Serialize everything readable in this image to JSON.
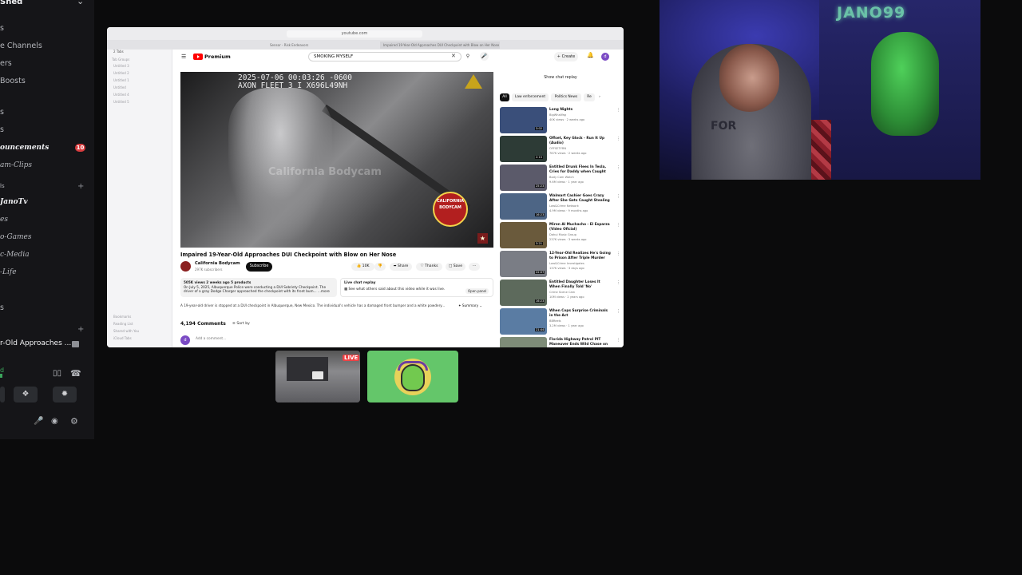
{
  "sidebar": {
    "server_title": "Shed",
    "lines": [
      "s",
      "e Channels",
      "ers",
      "Boosts",
      "s",
      "s"
    ],
    "channels": [
      "ouncements",
      "am-Clips",
      "JanoTv",
      "es",
      "o-Games",
      "c-Media",
      "-Life"
    ],
    "announcements_badge": "10",
    "sections": [
      "ls",
      "s"
    ],
    "voice_status_title": "r-Old Approaches ...",
    "connection": "d"
  },
  "browser": {
    "url": "youtube.com",
    "tabs": [
      "Sensor - Risk Endeavors",
      "Impaired 19-Year-Old Approaches DUI Checkpoint with Blow on Her Nose",
      ""
    ],
    "side_items": [
      "2 Tabs",
      "Untitled 3",
      "Untitled 2",
      "Untitled 1",
      "Untitled",
      "Untitled 4",
      "Untitled 5",
      "Bookmarks",
      "Reading List",
      "Shared with You",
      "iCloud Tabs"
    ],
    "side_heading": "Tab Groups"
  },
  "youtube": {
    "brand": "Premium",
    "search_value": "SMOKING MYSELF",
    "create_label": "Create",
    "avatar_letter": "d",
    "video": {
      "osd_line1": "2025-07-06 00:03:26 -0600",
      "osd_line2": "AXON FLEET 3 I X696L49NH",
      "watermark": "California Bodycam",
      "badge_text": "CALIFORNIA BODYCAM",
      "title": "Impaired 19-Year-Old Approaches DUI Checkpoint with Blow on Her Nose",
      "channel": "California Bodycam",
      "subscribers": "297K subscribers",
      "subscribe_label": "Subscribe",
      "likes": "10K",
      "share_label": "Share",
      "thanks_label": "Thanks",
      "save_label": "Save",
      "desc_stats": "505K views  2 weeks ago  5 products",
      "desc_text": "On July 5, 2025, Albuquerque Police were conducting a DUI Sobriety Checkpoint. The driver of a gray Dodge Charger approached the checkpoint with its front bum... ...more",
      "live_chat_title": "Live chat replay",
      "live_chat_text": "See what others said about this video while it was live.",
      "open_panel": "Open panel",
      "summary_text": "A 19-year-old driver is stopped at a DUI checkpoint in Albuquerque, New Mexico. The individual's vehicle has a damaged front bumper and a white powdery...",
      "summary_btn": "Summary",
      "comments_count": "4,194 Comments",
      "sort_by": "Sort by",
      "add_comment": "Add a comment..."
    },
    "show_chat_replay": "Show chat replay",
    "chips": [
      "All",
      "Law enforcement",
      "Politics News",
      "Re"
    ],
    "recommendations": [
      {
        "title": "Long Nights",
        "channel": "BigWhalYag",
        "meta": "40K views · 2 weeks ago",
        "duration": "3:02",
        "color": "#3a4f7a"
      },
      {
        "title": "Offset, Key Glock - Run It Up (Audio)",
        "channel": "OFFSETYRN",
        "meta": "787K views · 2 weeks ago",
        "duration": "2:15",
        "color": "#2d3b36"
      },
      {
        "title": "Entitled Drunk Flees In Tesla, Cries for Daddy when Caught",
        "channel": "Body Cam Watch",
        "meta": "9.6M views · 1 year ago",
        "duration": "25:23",
        "color": "#5b5a6a"
      },
      {
        "title": "Walmart Cashier Goes Crazy After She Gets Caught Stealing",
        "channel": "Law&Crime Network",
        "meta": "4.9M views · 9 months ago",
        "duration": "16:23",
        "color": "#4d6585"
      },
      {
        "title": "Miren Al Muchacho - El Esparza (Video Oficial)",
        "channel": "Dahui Music Group",
        "meta": "237K views · 3 weeks ago",
        "duration": "3:21",
        "color": "#6a5a3c"
      },
      {
        "title": "12-Year-Old Realizes He's Going to Prison After Triple Murder",
        "channel": "Law&Crime Investigates",
        "meta": "137K views · 3 days ago",
        "duration": "22:07",
        "color": "#7a7d85"
      },
      {
        "title": "Entitled Daughter Loses It When Finally Told 'No'",
        "channel": "Crime Scene Cam",
        "meta": "10M views · 2 years ago",
        "duration": "16:23",
        "color": "#5d6a5c"
      },
      {
        "title": "When Cops Surprise Criminals in the Act",
        "channel": "BBReels",
        "meta": "3.2M views · 1 year ago",
        "duration": "21:44",
        "color": "#5a7ca3"
      },
      {
        "title": "Florida Highway Patrol PIT Maneuver Ends Wild Chase on",
        "channel": "",
        "meta": "",
        "duration": "",
        "color": "#7e8c78"
      }
    ]
  },
  "webcam": {
    "sign_text": "JANO99",
    "shirt_text": "FOR"
  },
  "tiles": {
    "live_label": "LIVE"
  }
}
